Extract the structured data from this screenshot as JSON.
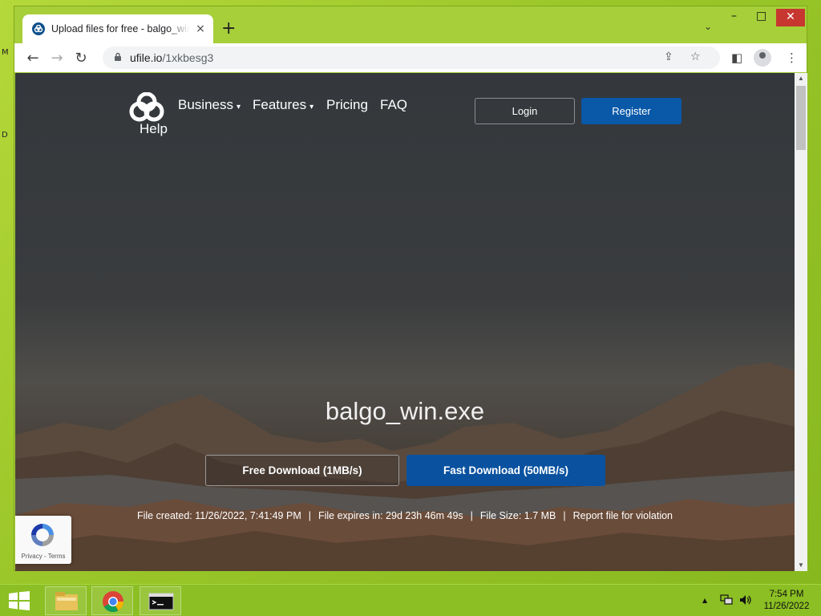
{
  "desktop": {
    "glyph1": "M",
    "glyph2": "D"
  },
  "browser": {
    "tab": {
      "title": "Upload files for free - balgo_win.exe",
      "close_icon": "×"
    },
    "new_tab_icon": "+",
    "tab_search_icon": "⌄",
    "window_controls": {
      "minimize": "–",
      "maximize": "□",
      "close": "✕"
    },
    "toolbar": {
      "back_icon": "←",
      "forward_icon": "→",
      "reload_icon": "↻",
      "lock_icon": "🔒",
      "url_host": "ufile.io",
      "url_path": "/1xkbesg3",
      "share_icon": "⇪",
      "bookmark_icon": "☆",
      "sidepanel_icon": "◧",
      "menu_icon": "⋮"
    }
  },
  "page": {
    "nav": {
      "help": "Help",
      "links": [
        {
          "label": "Business",
          "caret": "▾"
        },
        {
          "label": "Features",
          "caret": "▾"
        },
        {
          "label": "Pricing"
        },
        {
          "label": "FAQ"
        }
      ],
      "login": "Login",
      "register": "Register"
    },
    "file": {
      "name": "balgo_win.exe",
      "free_download": "Free Download (1MB/s)",
      "fast_download": "Fast Download (50MB/s)",
      "created": "File created: 11/26/2022, 7:41:49 PM",
      "expires": "File expires in: 29d 23h 46m 49s",
      "size": "File Size: 1.7 MB",
      "report": "Report file for violation",
      "separator": "|"
    },
    "recaptcha": {
      "links": "Privacy - Terms"
    }
  },
  "colors": {
    "register_bg": "#0a58a8",
    "fast_download_bg": "#0a52a0",
    "desktop_green": "#9cc72a"
  },
  "taskbar": {
    "tray_arrow": "▲",
    "time": "7:54 PM",
    "date": "11/26/2022"
  }
}
